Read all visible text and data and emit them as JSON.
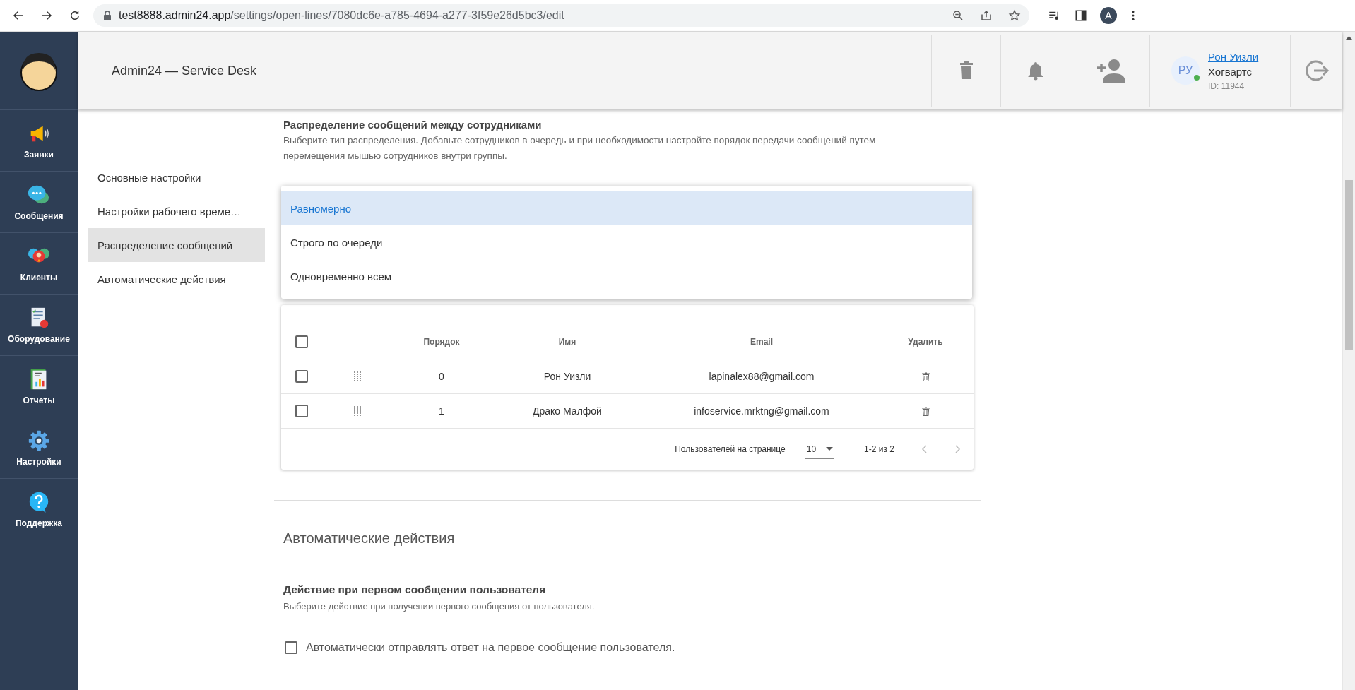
{
  "browser": {
    "url_host": "test8888.admin24.app",
    "url_path": "/settings/open-lines/7080dc6e-a785-4694-a277-3f59e26d5bc3/edit",
    "profile_initial": "A"
  },
  "sidebar": {
    "items": [
      {
        "label": "Заявки"
      },
      {
        "label": "Сообщения"
      },
      {
        "label": "Клиенты"
      },
      {
        "label": "Оборудование"
      },
      {
        "label": "Отчеты"
      },
      {
        "label": "Настройки"
      },
      {
        "label": "Поддержка"
      }
    ]
  },
  "header": {
    "title": "Admin24 — Service Desk",
    "user": {
      "initials": "РУ",
      "name": "Рон Уизли",
      "org": "Хогвартс",
      "id": "ID: 11944",
      "online": true
    }
  },
  "nav": {
    "items": [
      {
        "label": "Основные настройки",
        "selected": false
      },
      {
        "label": "Настройки рабочего време…",
        "selected": false
      },
      {
        "label": "Распределение сообщений",
        "selected": true
      },
      {
        "label": "Автоматические действия",
        "selected": false
      }
    ]
  },
  "distribution": {
    "title": "Распределение сообщений между сотрудниками",
    "description": "Выберите тип распределения. Добавьте сотрудников в очередь и при необходимости настройте порядок передачи сообщений путем перемещения мышью сотрудников внутри группы.",
    "dropdown": {
      "options": [
        {
          "label": "Равномерно",
          "selected": true
        },
        {
          "label": "Строго по очереди",
          "selected": false
        },
        {
          "label": "Одновременно всем",
          "selected": false
        }
      ]
    }
  },
  "table": {
    "select_all_checked": false,
    "columns": [
      "Порядок",
      "Имя",
      "Email",
      "Удалить"
    ],
    "rows": [
      {
        "checked": false,
        "order": "0",
        "name": "Рон Уизли",
        "email": "lapinalex88@gmail.com"
      },
      {
        "checked": false,
        "order": "1",
        "name": "Драко Малфой",
        "email": "infoservice.mrktng@gmail.com"
      }
    ],
    "footer": {
      "rows_per_page_label": "Пользователей на странице",
      "rows_per_page": "10",
      "range": "1-2 из 2"
    }
  },
  "auto": {
    "title": "Автоматические действия",
    "subtitle": "Действие при первом сообщении пользователя",
    "description": "Выберите действие при получении первого сообщения от пользователя.",
    "checkbox": {
      "label": "Автоматически отправлять ответ на первое сообщение пользователя.",
      "checked": false
    }
  }
}
